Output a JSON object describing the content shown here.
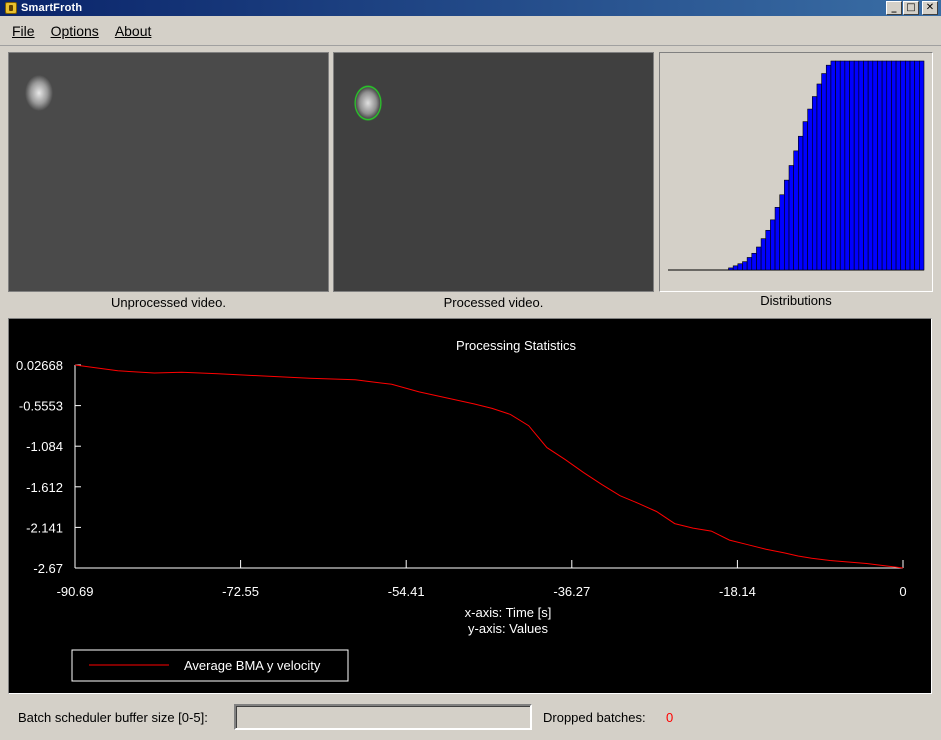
{
  "window": {
    "title": "SmartFroth",
    "icon": "app-icon"
  },
  "menu": {
    "file": "File",
    "options": "Options",
    "about": "About"
  },
  "panels": {
    "unprocessed_caption": "Unprocessed video.",
    "processed_caption": "Processed video.",
    "distributions_caption": "Distributions"
  },
  "distribution": {
    "bar_color": "#0000ff",
    "values": [
      0.0,
      0.0,
      0.0,
      0.0,
      0.0,
      0.0,
      0.0,
      0.0,
      0.0,
      0.0,
      0.0,
      0.0,
      0.0,
      0.01,
      0.02,
      0.03,
      0.04,
      0.06,
      0.08,
      0.11,
      0.15,
      0.19,
      0.24,
      0.3,
      0.36,
      0.43,
      0.5,
      0.57,
      0.64,
      0.71,
      0.77,
      0.83,
      0.89,
      0.94,
      0.98,
      1.0,
      1.0,
      1.0,
      1.0,
      1.0,
      1.0,
      1.0,
      1.0,
      1.0,
      1.0,
      1.0,
      1.0,
      1.0,
      1.0,
      1.0,
      1.0,
      1.0,
      1.0,
      1.0,
      1.0
    ]
  },
  "chart_data": {
    "type": "line",
    "title": "Processing Statistics",
    "xlabel": "x-axis: Time [s]",
    "ylabel": "y-axis: Values",
    "xlim": [
      -90.69,
      0
    ],
    "ylim": [
      -2.67,
      0.02668
    ],
    "x_ticks": [
      "-90.69",
      "-72.55",
      "-54.41",
      "-36.27",
      "-18.14",
      "0"
    ],
    "y_ticks": [
      "0.02668",
      "-0.5553",
      "-1.084",
      "-1.612",
      "-2.141",
      "-2.67"
    ],
    "series": [
      {
        "name": "Average BMA y velocity",
        "color": "#ff0000",
        "x": [
          -90.69,
          -86.0,
          -82.0,
          -79.0,
          -75.0,
          -70.0,
          -65.0,
          -60.0,
          -56.0,
          -53.0,
          -50.0,
          -47.0,
          -45.0,
          -43.0,
          -41.0,
          -39.0,
          -37.0,
          -35.0,
          -33.0,
          -31.0,
          -29.0,
          -27.0,
          -25.0,
          -23.0,
          -21.0,
          -19.0,
          -17.0,
          -15.0,
          -13.0,
          -11.5,
          -10.0,
          -8.0,
          -6.0,
          -4.0,
          -2.0,
          0.0
        ],
        "y": [
          0.02668,
          -0.05,
          -0.08,
          -0.07,
          -0.09,
          -0.12,
          -0.15,
          -0.17,
          -0.23,
          -0.33,
          -0.41,
          -0.49,
          -0.55,
          -0.63,
          -0.78,
          -1.07,
          -1.23,
          -1.4,
          -1.56,
          -1.71,
          -1.81,
          -1.92,
          -2.08,
          -2.14,
          -2.18,
          -2.3,
          -2.36,
          -2.42,
          -2.47,
          -2.51,
          -2.54,
          -2.57,
          -2.59,
          -2.61,
          -2.64,
          -2.67
        ]
      }
    ],
    "grid": false,
    "legend": "bottom-left"
  },
  "bottom": {
    "buffer_label": "Batch scheduler buffer size [0-5]:",
    "buffer_value": "",
    "dropped_label": "Dropped batches:",
    "dropped_value": "0",
    "dropped_color": "#ff0000"
  }
}
